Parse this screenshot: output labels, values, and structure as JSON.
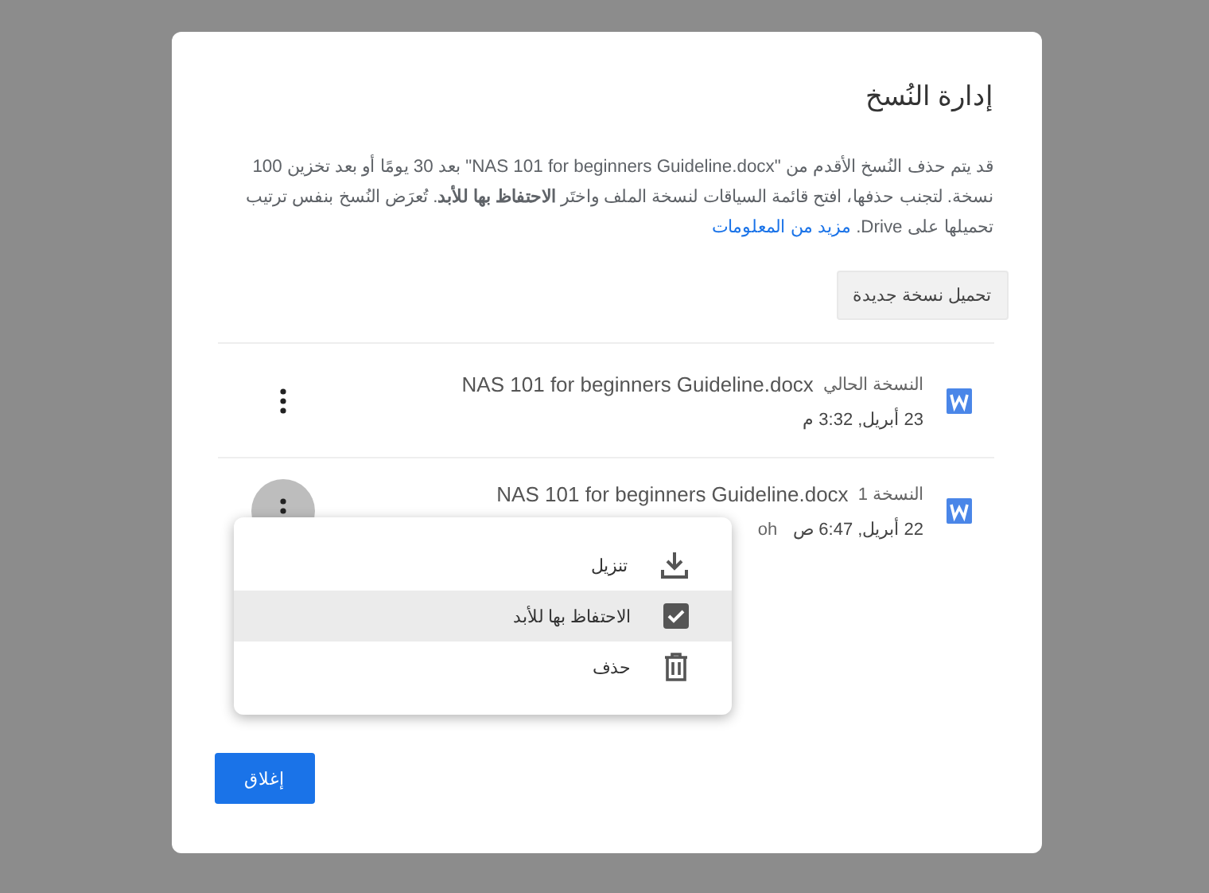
{
  "dialog": {
    "title": "إدارة النُسخ",
    "description": "قد يتم حذف النُسخ الأقدم من \"NAS 101 for beginners Guideline.docx\" بعد 30 يومًا أو بعد تخزين 100 نسخة. لتجنب حذفها، افتح قائمة السياقات لنسخة الملف واختَر **الاحتفاظ بها للأبد**. تُعرَض النُسخ بنفس ترتيب تحميلها على Drive.",
    "learn_more_link": "مزيد من المعلومات",
    "upload_button": "تحميل نسخة جديدة",
    "versions": [
      {
        "label": "النسخة الحالي",
        "file_name": "NAS 101 for beginners Guideline.docx",
        "date": "23 أبريل, 3:32 م",
        "menu_open": false
      },
      {
        "label": "النسخة 1",
        "file_name": "NAS 101 for beginners Guideline.docx",
        "date": "22 أبريل, 6:47 ص",
        "author": "oh",
        "menu_open": true
      }
    ],
    "menu": [
      {
        "kind": "download",
        "label": "تنزيل",
        "selected": false
      },
      {
        "kind": "checkbox",
        "label": "الاحتفاظ بها للأبد",
        "checked": true,
        "selected": true
      },
      {
        "kind": "delete",
        "label": "حذف",
        "selected": false
      }
    ],
    "close_button": "إغلاق"
  }
}
